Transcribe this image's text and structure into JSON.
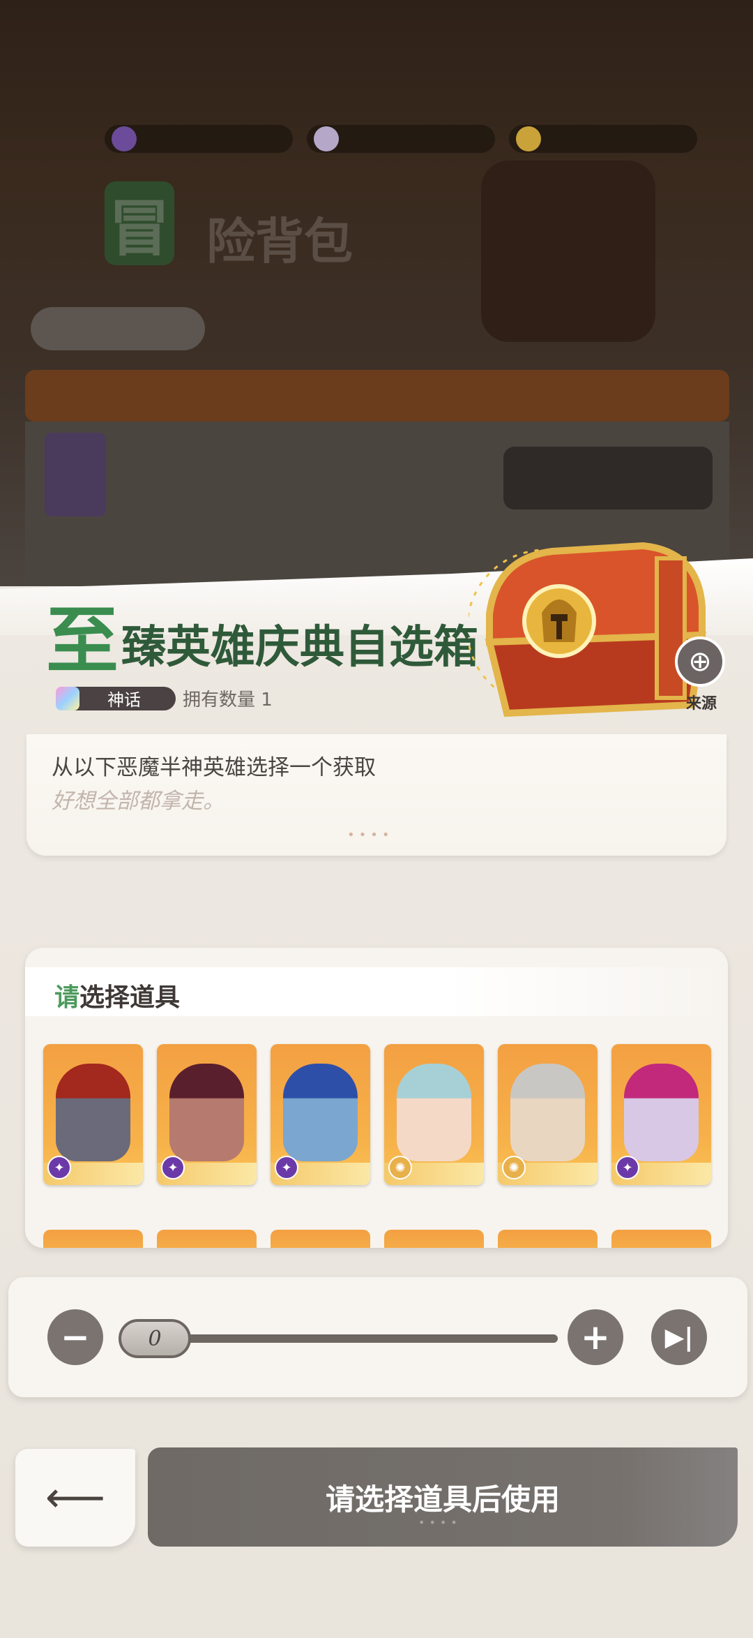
{
  "background": {
    "resources": [
      {
        "icon": "purple-crystal-icon",
        "color": "#6b4b9a"
      },
      {
        "icon": "diamond-icon",
        "color": "#b4a7c8"
      },
      {
        "icon": "gold-coin-icon",
        "color": "#c9a23a"
      }
    ],
    "title_badge": "冒",
    "title_text": "险背包"
  },
  "item": {
    "title_first_char": "至",
    "title_rest": "臻英雄庆典自选箱",
    "rarity": "神话",
    "owned": "拥有数量 1",
    "source_label": "来源",
    "description": "从以下恶魔半神英雄选择一个获取",
    "flavor": "好想全部都拿走。"
  },
  "selection": {
    "title_accent": "请",
    "title_rest": "选择道具",
    "heroes": [
      {
        "name": "demon-horned-hero",
        "face": "#6b6a7a",
        "hair": "#a3281d",
        "faction": "demon",
        "faction_color": "#6b3aa8"
      },
      {
        "name": "dark-armored-hero",
        "face": "#b67a6e",
        "hair": "#5a1f2d",
        "faction": "demon",
        "faction_color": "#6b3aa8"
      },
      {
        "name": "ice-crown-hero",
        "face": "#7aa6cf",
        "hair": "#2e4fa8",
        "faction": "demon",
        "faction_color": "#6b3aa8"
      },
      {
        "name": "twin-maidens-hero",
        "face": "#f4d9c7",
        "hair": "#a6d0d6",
        "faction": "celestial",
        "faction_color": "#e8b04a"
      },
      {
        "name": "silver-helm-hero",
        "face": "#e9d6c1",
        "hair": "#c9c7c3",
        "faction": "celestial",
        "faction_color": "#e8b04a"
      },
      {
        "name": "pink-demoness-hero",
        "face": "#d8c8e6",
        "hair": "#c2297a",
        "faction": "demon",
        "faction_color": "#6b3aa8"
      }
    ]
  },
  "stepper": {
    "value": "0",
    "value_fraction": 0,
    "minus_icon": "minus-icon",
    "plus_icon": "plus-icon",
    "max_icon": "skip-to-end-icon"
  },
  "footer": {
    "back_icon": "back-arrow-icon",
    "use_label": "请选择道具后使用"
  }
}
